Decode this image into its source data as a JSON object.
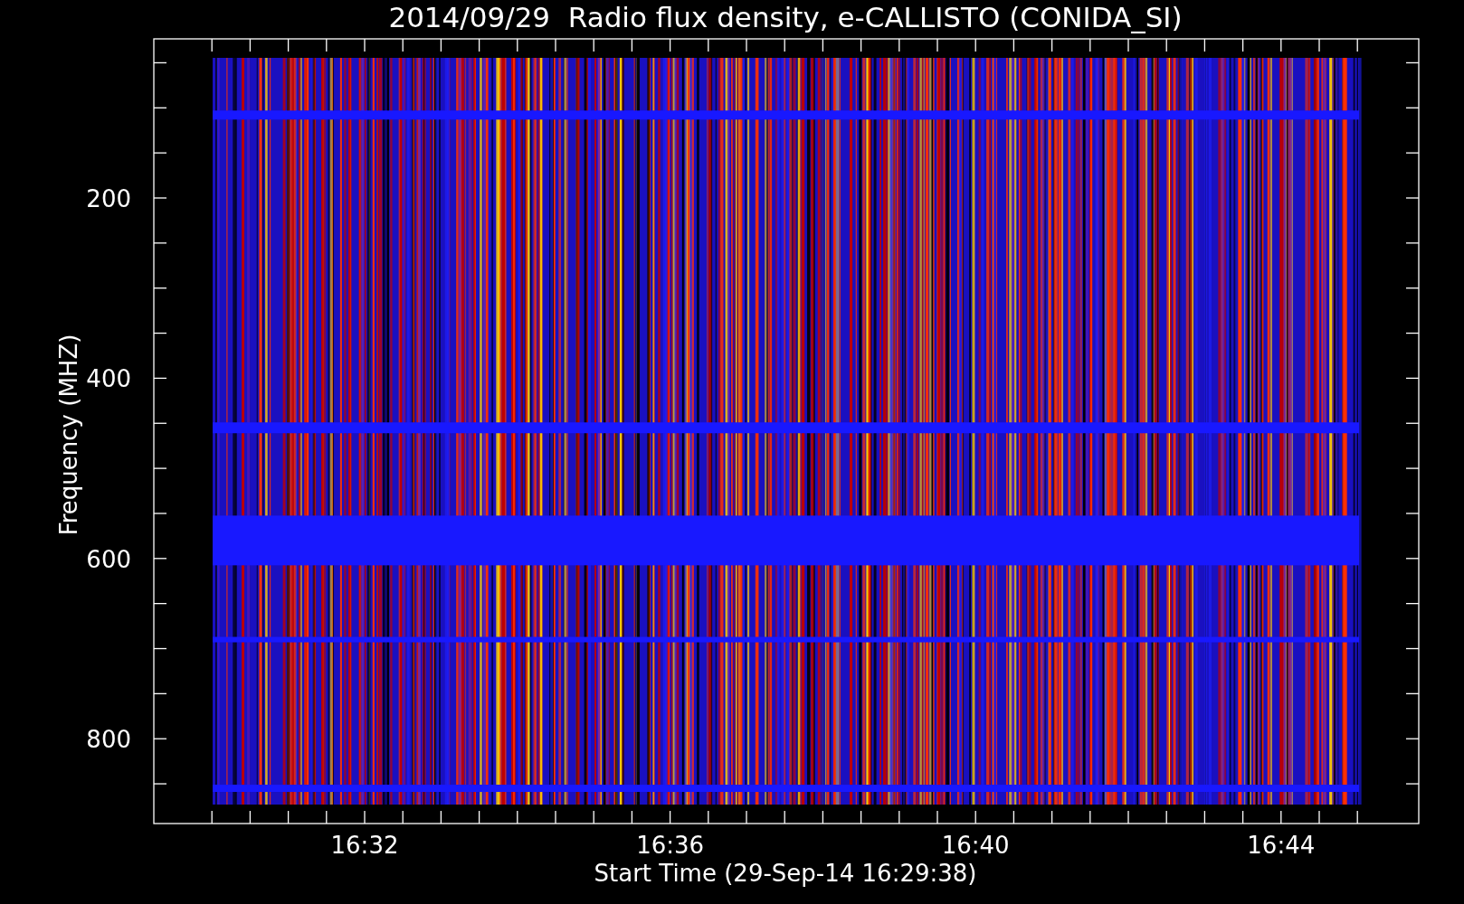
{
  "title": "2014/09/29  Radio flux density, e-CALLISTO (CONIDA_SI)",
  "y_axis": {
    "label": "Frequency (MHZ)",
    "ticks": [
      "200",
      "400",
      "600",
      "800"
    ]
  },
  "x_axis": {
    "label": "Start Time (29-Sep-14 16:29:38)",
    "ticks": [
      "16:32",
      "16:36",
      "16:40",
      "16:44"
    ]
  }
}
